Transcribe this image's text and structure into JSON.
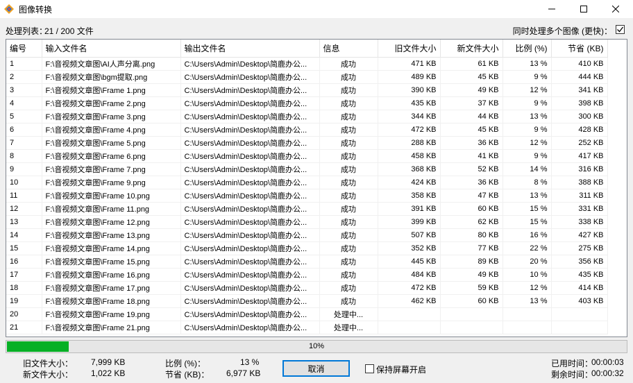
{
  "window": {
    "title": "图像转换"
  },
  "toolbar": {
    "queue_label": "处理列表：",
    "queue_count": "21 / 200 文件",
    "multi_label": "同时处理多个图像 (更快)：",
    "multi_checked": true
  },
  "table": {
    "columns": [
      "编号",
      "输入文件名",
      "输出文件名",
      "信息",
      "旧文件大小",
      "新文件大小",
      "比例 (%)",
      "节省 (KB)"
    ],
    "rows": [
      [
        "1",
        "F:\\音视频文章图\\AI人声分离.png",
        "C:\\Users\\Admin\\Desktop\\简鹿办公...",
        "成功",
        "471 KB",
        "61 KB",
        "13 %",
        "410 KB"
      ],
      [
        "2",
        "F:\\音视频文章图\\bgm提取.png",
        "C:\\Users\\Admin\\Desktop\\简鹿办公...",
        "成功",
        "489 KB",
        "45 KB",
        "9 %",
        "444 KB"
      ],
      [
        "3",
        "F:\\音视频文章图\\Frame 1.png",
        "C:\\Users\\Admin\\Desktop\\简鹿办公...",
        "成功",
        "390 KB",
        "49 KB",
        "12 %",
        "341 KB"
      ],
      [
        "4",
        "F:\\音视频文章图\\Frame 2.png",
        "C:\\Users\\Admin\\Desktop\\简鹿办公...",
        "成功",
        "435 KB",
        "37 KB",
        "9 %",
        "398 KB"
      ],
      [
        "5",
        "F:\\音视频文章图\\Frame 3.png",
        "C:\\Users\\Admin\\Desktop\\简鹿办公...",
        "成功",
        "344 KB",
        "44 KB",
        "13 %",
        "300 KB"
      ],
      [
        "6",
        "F:\\音视频文章图\\Frame 4.png",
        "C:\\Users\\Admin\\Desktop\\简鹿办公...",
        "成功",
        "472 KB",
        "45 KB",
        "9 %",
        "428 KB"
      ],
      [
        "7",
        "F:\\音视频文章图\\Frame 5.png",
        "C:\\Users\\Admin\\Desktop\\简鹿办公...",
        "成功",
        "288 KB",
        "36 KB",
        "12 %",
        "252 KB"
      ],
      [
        "8",
        "F:\\音视频文章图\\Frame 6.png",
        "C:\\Users\\Admin\\Desktop\\简鹿办公...",
        "成功",
        "458 KB",
        "41 KB",
        "9 %",
        "417 KB"
      ],
      [
        "9",
        "F:\\音视频文章图\\Frame 7.png",
        "C:\\Users\\Admin\\Desktop\\简鹿办公...",
        "成功",
        "368 KB",
        "52 KB",
        "14 %",
        "316 KB"
      ],
      [
        "10",
        "F:\\音视频文章图\\Frame 9.png",
        "C:\\Users\\Admin\\Desktop\\简鹿办公...",
        "成功",
        "424 KB",
        "36 KB",
        "8 %",
        "388 KB"
      ],
      [
        "11",
        "F:\\音视频文章图\\Frame 10.png",
        "C:\\Users\\Admin\\Desktop\\简鹿办公...",
        "成功",
        "358 KB",
        "47 KB",
        "13 %",
        "311 KB"
      ],
      [
        "12",
        "F:\\音视频文章图\\Frame 11.png",
        "C:\\Users\\Admin\\Desktop\\简鹿办公...",
        "成功",
        "391 KB",
        "60 KB",
        "15 %",
        "331 KB"
      ],
      [
        "13",
        "F:\\音视频文章图\\Frame 12.png",
        "C:\\Users\\Admin\\Desktop\\简鹿办公...",
        "成功",
        "399 KB",
        "62 KB",
        "15 %",
        "338 KB"
      ],
      [
        "14",
        "F:\\音视频文章图\\Frame 13.png",
        "C:\\Users\\Admin\\Desktop\\简鹿办公...",
        "成功",
        "507 KB",
        "80 KB",
        "16 %",
        "427 KB"
      ],
      [
        "15",
        "F:\\音视频文章图\\Frame 14.png",
        "C:\\Users\\Admin\\Desktop\\简鹿办公...",
        "成功",
        "352 KB",
        "77 KB",
        "22 %",
        "275 KB"
      ],
      [
        "16",
        "F:\\音视频文章图\\Frame 15.png",
        "C:\\Users\\Admin\\Desktop\\简鹿办公...",
        "成功",
        "445 KB",
        "89 KB",
        "20 %",
        "356 KB"
      ],
      [
        "17",
        "F:\\音视频文章图\\Frame 16.png",
        "C:\\Users\\Admin\\Desktop\\简鹿办公...",
        "成功",
        "484 KB",
        "49 KB",
        "10 %",
        "435 KB"
      ],
      [
        "18",
        "F:\\音视频文章图\\Frame 17.png",
        "C:\\Users\\Admin\\Desktop\\简鹿办公...",
        "成功",
        "472 KB",
        "59 KB",
        "12 %",
        "414 KB"
      ],
      [
        "19",
        "F:\\音视频文章图\\Frame 18.png",
        "C:\\Users\\Admin\\Desktop\\简鹿办公...",
        "成功",
        "462 KB",
        "60 KB",
        "13 %",
        "403 KB"
      ],
      [
        "20",
        "F:\\音视频文章图\\Frame 19.png",
        "C:\\Users\\Admin\\Desktop\\简鹿办公...",
        "处理中...",
        "",
        "",
        "",
        ""
      ],
      [
        "21",
        "F:\\音视频文章图\\Frame 21.png",
        "C:\\Users\\Admin\\Desktop\\简鹿办公...",
        "处理中...",
        "",
        "",
        "",
        ""
      ]
    ]
  },
  "progress": {
    "fraction": 0.1,
    "text": "10%",
    "color": "#06b025"
  },
  "stats": {
    "old_size_label": "旧文件大小：",
    "old_size_value": "7,999 KB",
    "new_size_label": "新文件大小：",
    "new_size_value": "1,022 KB",
    "ratio_label": "比例 (%)：",
    "ratio_value": "13 %",
    "saved_label": "节省 (KB)：",
    "saved_value": "6,977 KB",
    "elapsed_label": "已用时间：",
    "elapsed_value": "00:00:03",
    "remaining_label": "剩余时间：",
    "remaining_value": "00:00:32"
  },
  "actions": {
    "cancel_label": "取消",
    "keep_screen_label": "保持屏幕开启",
    "keep_screen_checked": false
  },
  "icons": {
    "app": "app-logo-icon",
    "minimize": "minimize-icon",
    "maximize": "maximize-icon",
    "close": "close-icon",
    "check": "checkmark-icon"
  }
}
